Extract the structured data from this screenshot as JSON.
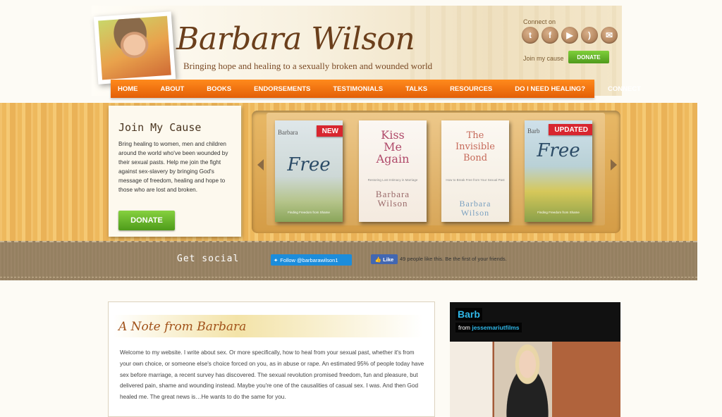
{
  "header": {
    "title": "Barbara Wilson",
    "tagline": "Bringing hope and healing to a sexually broken and wounded world",
    "connect_label": "Connect on",
    "social_icons": [
      {
        "name": "twitter-icon",
        "glyph": "t"
      },
      {
        "name": "facebook-icon",
        "glyph": "f"
      },
      {
        "name": "youtube-icon",
        "glyph": "▶"
      },
      {
        "name": "rss-icon",
        "glyph": ")"
      },
      {
        "name": "email-icon",
        "glyph": "✉"
      }
    ],
    "join_label": "Join my cause",
    "donate_label": "DONATE"
  },
  "nav": {
    "items": [
      "HOME",
      "ABOUT",
      "BOOKS",
      "ENDORSEMENTS",
      "TESTIMONIALS",
      "TALKS",
      "RESOURCES",
      "DO I NEED HEALING?",
      "CONNECT"
    ]
  },
  "cause": {
    "title": "Join My Cause",
    "text": "Bring healing to women, men and children around the world who've been wounded by their sexual pasts. Help me join the fight against sex-slavery by bringing God's message of freedom, healing and hope to those who are lost and broken.",
    "donate_label": "DONATE"
  },
  "books": [
    {
      "title": "Free",
      "author": "Barbara",
      "ribbon": "NEW",
      "subtitle": "Finding Freedom from Shame"
    },
    {
      "title": "Kiss Me Again",
      "author": "Barbara Wilson",
      "ribbon": "",
      "subtitle": "Restoring Lost Intimacy in Marriage"
    },
    {
      "title": "The Invisible Bond",
      "author": "Barbara Wilson",
      "ribbon": "",
      "subtitle": "How to Break Free from Your Sexual Past"
    },
    {
      "title": "Free",
      "author": "Barb",
      "ribbon": "UPDATED",
      "subtitle": "Finding Freedom from Shame"
    }
  ],
  "social": {
    "label": "Get social",
    "twitter_follow": "Follow @barbarawilson1",
    "fb_like": "Like",
    "fb_text": "49 people like this. Be the first of your friends."
  },
  "note": {
    "title": "A Note from Barbara",
    "text": "Welcome to my website. I write about sex. Or more specifically, how to heal from your sexual past, whether it's from your own choice, or someone else's choice forced on you, as in abuse or rape. An estimated 95% of people today have sex before marriage, a recent survey has discovered. The sexual revolution promised freedom, fun and pleasure, but delivered pain, shame and wounding instead. Maybe you're one of the causalities of casual sex. I was. And then God healed me. The great news is…He wants to do the same for you."
  },
  "video": {
    "title": "Barb",
    "from_label": "from",
    "channel": "jessemariutfilms"
  },
  "colors": {
    "nav_orange": "#f0740f",
    "donate_green": "#5aad24",
    "title_brown": "#6b3f1c",
    "ribbon_red": "#d8262f"
  }
}
